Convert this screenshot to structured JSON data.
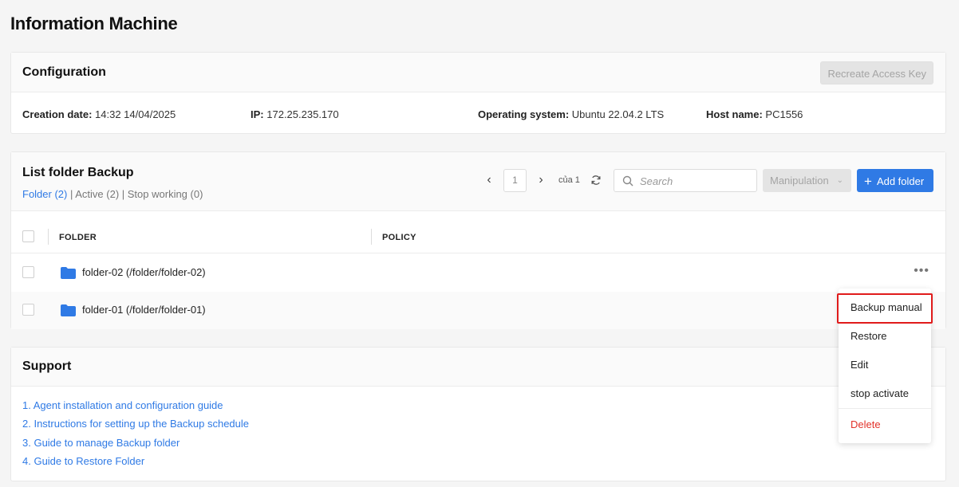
{
  "page": {
    "title": "Information Machine"
  },
  "config": {
    "title": "Configuration",
    "recreate_button": "Recreate Access Key",
    "creation_label": "Creation date:",
    "creation_value": "14:32 14/04/2025",
    "ip_label": "IP:",
    "ip_value": "172.25.235.170",
    "os_label": "Operating system:",
    "os_value": "Ubuntu 22.04.2 LTS",
    "host_label": "Host name:",
    "host_value": "PC1556"
  },
  "list": {
    "title": "List folder Backup",
    "filter_folder": "Folder (2)",
    "filter_sep1": " | ",
    "filter_active": "Active (2)",
    "filter_sep2": " | ",
    "filter_stop": "Stop working (0)",
    "pager_prev": "‹",
    "page_number": "1",
    "pager_next": "›",
    "pager_of": "của 1",
    "search_placeholder": "Search",
    "manipulation": "Manipulation",
    "add_folder": "Add folder",
    "columns": [
      "FOLDER",
      "POLICY"
    ],
    "rows": [
      {
        "name": "folder-02 (/folder/folder-02)",
        "actions": "•••"
      },
      {
        "name": "folder-01 (/folder/folder-01)"
      }
    ]
  },
  "support": {
    "title": "Support",
    "links": [
      "1. Agent installation and configuration guide",
      "2. Instructions for setting up the Backup schedule",
      "3. Guide to manage Backup folder",
      "4. Guide to Restore Folder"
    ]
  },
  "menu": {
    "items": [
      "Backup manual",
      "Restore",
      "Edit",
      "stop activate"
    ],
    "delete": "Delete"
  },
  "colors": {
    "accent": "#2f7ae5",
    "danger": "#e2322a",
    "highlight": "#e01b1b"
  },
  "icons": [
    "search-icon",
    "refresh-icon",
    "folder-icon",
    "plus-icon",
    "more-icon",
    "chevron-down-icon"
  ]
}
